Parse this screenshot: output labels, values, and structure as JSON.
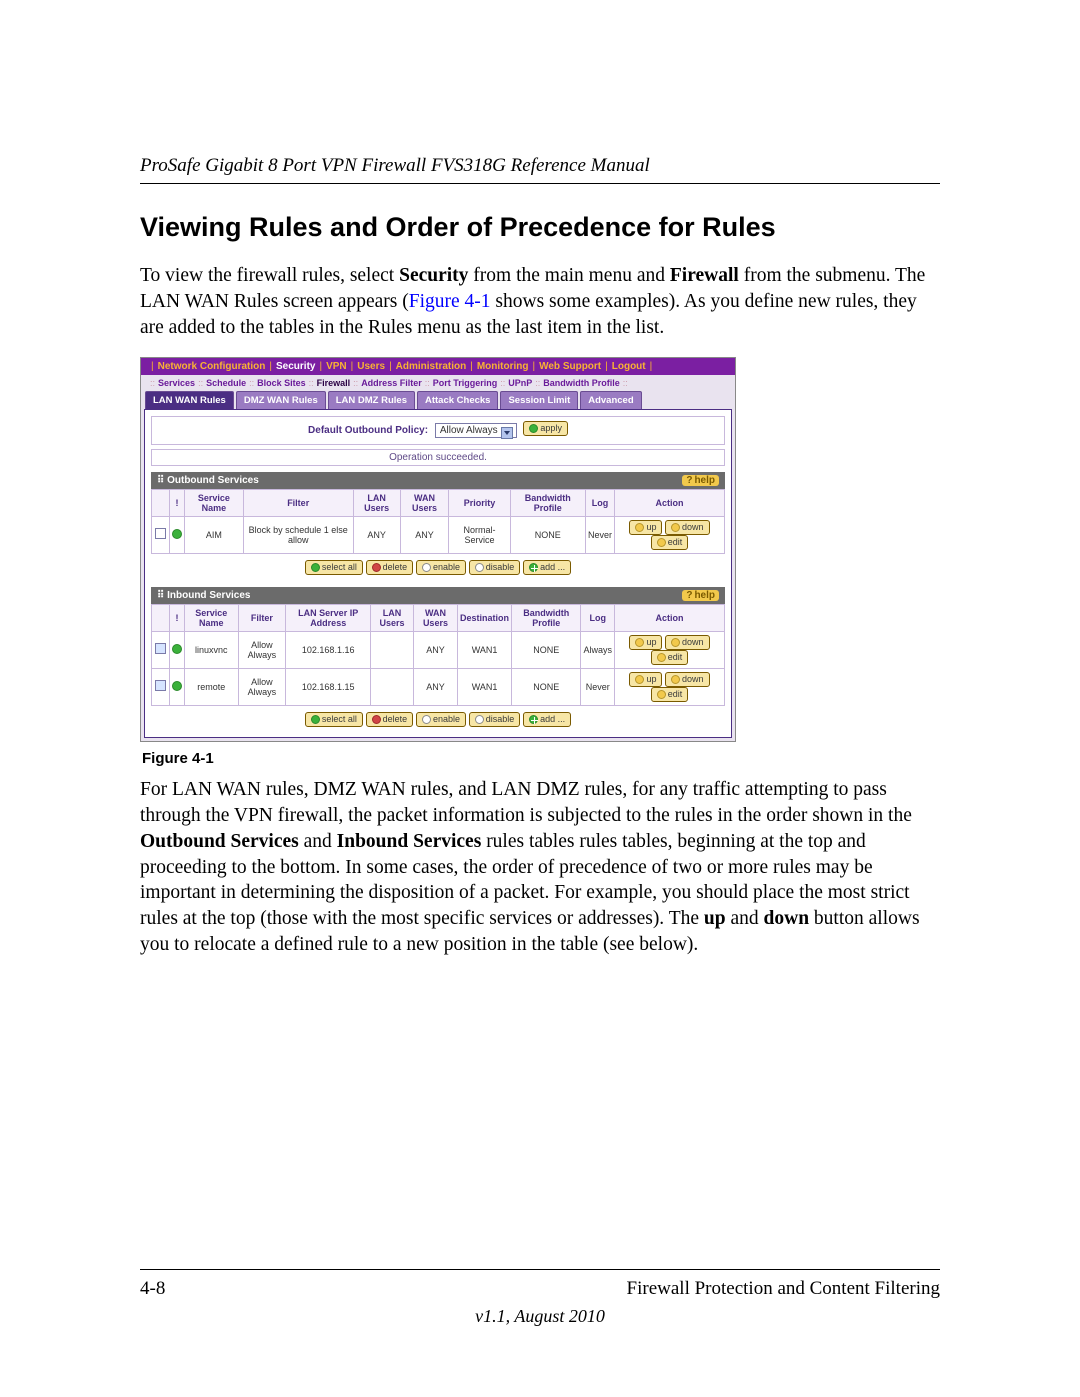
{
  "header": {
    "manual_title": "ProSafe Gigabit 8 Port VPN Firewall FVS318G Reference Manual"
  },
  "heading": "Viewing Rules and Order of Precedence for Rules",
  "para1_a": "To view the firewall rules, select ",
  "para1_b": " from the main menu and ",
  "para1_c": " from the submenu. The LAN WAN Rules screen appears (",
  "para1_d": " shows some examples). As you define new rules, they are added to the tables in the Rules menu as the last item in the list.",
  "bold_security": "Security",
  "bold_firewall": "Firewall",
  "fig_link": "Figure 4-1",
  "fig_caption": "Figure 4-1",
  "para2_a": "For LAN WAN rules, DMZ WAN rules, and LAN DMZ rules, for any traffic attempting to pass through the VPN firewall, the packet information is subjected to the rules in the order shown in the ",
  "para2_b": " and ",
  "para2_c": " rules tables rules tables, beginning at the top and proceeding to the bottom. In some cases, the order of precedence of two or more rules may be important in determining the disposition of a packet. For example, you should place the most strict rules at the top (those with the most specific services or addresses). The ",
  "para2_d": " and ",
  "para2_e": " button allows you to relocate a defined rule to a new position in the table (see below).",
  "bold_outbound": "Outbound Services",
  "bold_inbound": "Inbound Services",
  "bold_up": "up",
  "bold_down": "down",
  "footer": {
    "page_num": "4-8",
    "section": "Firewall Protection and Content Filtering",
    "version": "v1.1, August 2010"
  },
  "shot": {
    "topnav": [
      "Network Configuration",
      "Security",
      "VPN",
      "Users",
      "Administration",
      "Monitoring",
      "Web Support",
      "Logout"
    ],
    "subnav": [
      "Services",
      "Schedule",
      "Block Sites",
      "Firewall",
      "Address Filter",
      "Port Triggering",
      "UPnP",
      "Bandwidth Profile"
    ],
    "tabs": [
      "LAN WAN Rules",
      "DMZ WAN Rules",
      "LAN DMZ Rules",
      "Attack Checks",
      "Session Limit",
      "Advanced"
    ],
    "policy_label": "Default Outbound Policy:",
    "policy_value": "Allow Always",
    "apply_label": "apply",
    "op_msg": "Operation succeeded.",
    "help_label": "help",
    "outbound_title": "Outbound Services",
    "outbound_headers": [
      "",
      "!",
      "Service Name",
      "Filter",
      "LAN Users",
      "WAN Users",
      "Priority",
      "Bandwidth Profile",
      "Log",
      "Action"
    ],
    "outbound_rows": [
      {
        "service": "AIM",
        "filter": "Block by schedule 1 else allow",
        "lan": "ANY",
        "wan": "ANY",
        "priority": "Normal-Service",
        "bw": "NONE",
        "log": "Never"
      }
    ],
    "inbound_title": "Inbound Services",
    "inbound_headers": [
      "",
      "!",
      "Service Name",
      "Filter",
      "LAN Server IP Address",
      "LAN Users",
      "WAN Users",
      "Destination",
      "Bandwidth Profile",
      "Log",
      "Action"
    ],
    "inbound_rows": [
      {
        "service": "linuxvnc",
        "filter": "Allow Always",
        "ip": "102.168.1.16",
        "lan": "",
        "wan": "ANY",
        "dest": "WAN1",
        "bw": "NONE",
        "log": "Always"
      },
      {
        "service": "remote",
        "filter": "Allow Always",
        "ip": "102.168.1.15",
        "lan": "",
        "wan": "ANY",
        "dest": "WAN1",
        "bw": "NONE",
        "log": "Never"
      }
    ],
    "toolbar": {
      "select_all": "select all",
      "delete": "delete",
      "enable": "enable",
      "disable": "disable",
      "add": "add ...",
      "up": "up",
      "down": "down",
      "edit": "edit"
    }
  }
}
